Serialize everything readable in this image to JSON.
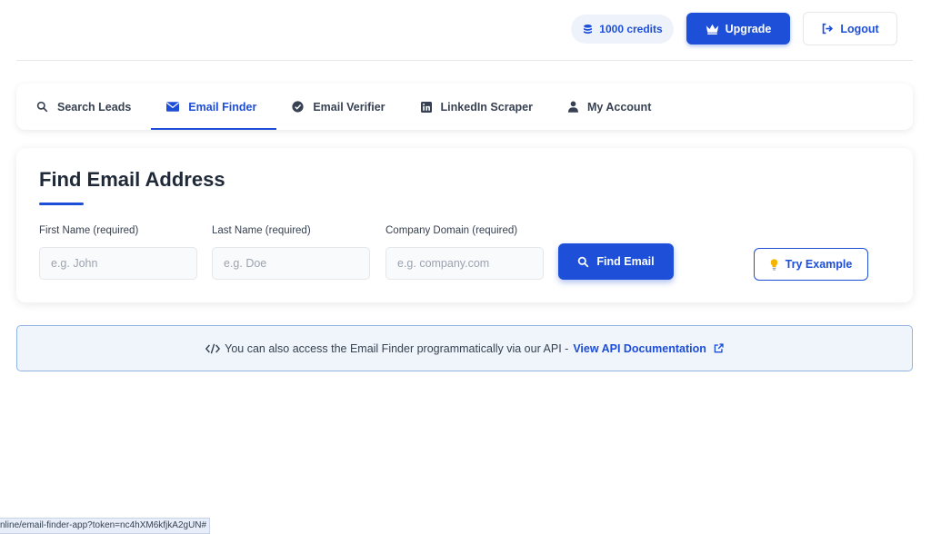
{
  "header": {
    "credits_label": "1000 credits",
    "upgrade_label": "Upgrade",
    "logout_label": "Logout"
  },
  "tabs": [
    {
      "label": "Search Leads",
      "icon": "search-icon",
      "active": false
    },
    {
      "label": "Email Finder",
      "icon": "envelope-icon",
      "active": true
    },
    {
      "label": "Email Verifier",
      "icon": "check-circle-icon",
      "active": false
    },
    {
      "label": "LinkedIn Scraper",
      "icon": "linkedin-icon",
      "active": false
    },
    {
      "label": "My Account",
      "icon": "user-icon",
      "active": false
    }
  ],
  "finder": {
    "title": "Find Email Address",
    "first_name": {
      "label": "First Name (required)",
      "placeholder": "e.g. John",
      "value": ""
    },
    "last_name": {
      "label": "Last Name (required)",
      "placeholder": "e.g. Doe",
      "value": ""
    },
    "company_domain": {
      "label": "Company Domain (required)",
      "placeholder": "e.g. company.com",
      "value": ""
    },
    "find_button_label": "Find Email",
    "try_example_label": "Try Example"
  },
  "api_banner": {
    "text": "You can also access the Email Finder programmatically via our API -",
    "link_label": "View API Documentation"
  },
  "status_bar": {
    "url": "nline/email-finder-app?token=nc4hXM6kfjkA2gUN#"
  },
  "colors": {
    "primary": "#1d4fd8",
    "banner_bg": "#eff5fb",
    "banner_border": "#93b4e0",
    "credits_bg": "#eef3fb"
  }
}
